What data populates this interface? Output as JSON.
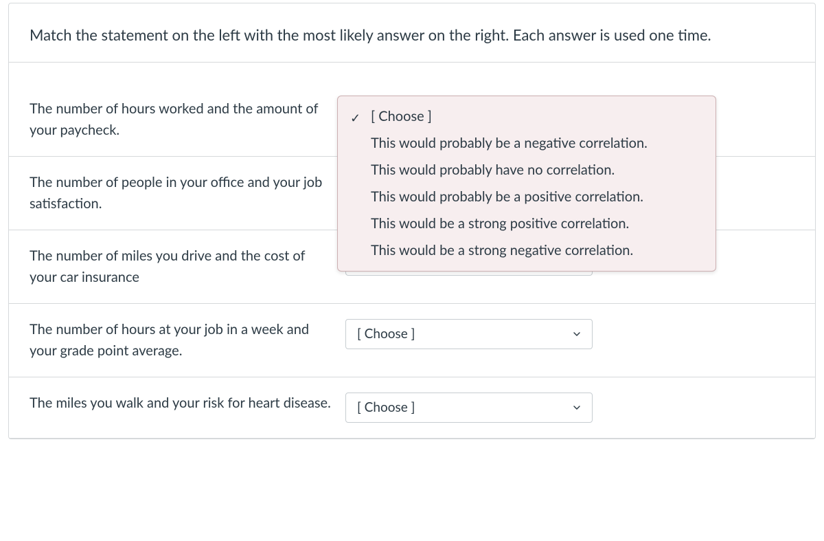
{
  "instructions": "Match the statement on the left with the most likely answer on the right.  Each answer is used one time.",
  "rows": [
    {
      "prompt": "The number of hours worked and the amount of your paycheck.",
      "select_value": "[ Choose ]",
      "dropdown_open": true
    },
    {
      "prompt": "The number of people in your office and your job satisfaction.",
      "select_value": "[ Choose ]",
      "dropdown_open": false
    },
    {
      "prompt": "The number of miles you drive and the cost of your car insurance",
      "select_value": "[ Choose ]",
      "dropdown_open": false
    },
    {
      "prompt": "The number of hours at your job in a week and your grade point average.",
      "select_value": "[ Choose ]",
      "dropdown_open": false
    },
    {
      "prompt": "The miles you walk and your risk for heart disease.",
      "select_value": "[ Choose ]",
      "dropdown_open": false
    }
  ],
  "dropdown": {
    "selected_label": "[ Choose ]",
    "options": [
      "This would probably be a negative correlation.",
      "This would probably have no correlation.",
      "This would probably be a positive correlation.",
      "This would be a strong positive correlation.",
      "This would be a strong negative correlation."
    ]
  }
}
